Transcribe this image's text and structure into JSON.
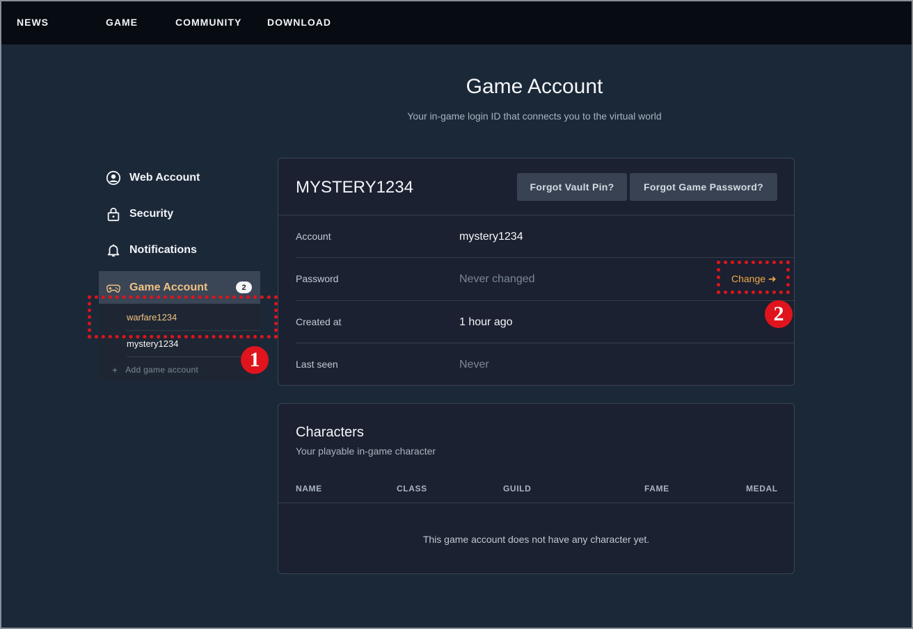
{
  "nav": {
    "items": [
      "NEWS",
      "GAME",
      "COMMUNITY",
      "DOWNLOAD"
    ]
  },
  "page": {
    "title": "Game Account",
    "subtitle": "Your in-game login ID that connects you to the virtual world"
  },
  "sidebar": {
    "items": [
      {
        "label": "Web Account",
        "icon": "user-circle-icon"
      },
      {
        "label": "Security",
        "icon": "lock-icon"
      },
      {
        "label": "Notifications",
        "icon": "bell-icon"
      }
    ],
    "game_account": {
      "label": "Game Account",
      "icon": "gamepad-icon",
      "badge": "2",
      "accounts": [
        "warfare1234",
        "mystery1234"
      ],
      "add_label": "Add game account",
      "add_symbol": "+"
    }
  },
  "account_card": {
    "name": "MYSTERY1234",
    "forgot_vault_pin": "Forgot Vault Pin?",
    "forgot_game_password": "Forgot Game Password?",
    "rows": {
      "account": {
        "label": "Account",
        "value": "mystery1234"
      },
      "password": {
        "label": "Password",
        "value": "Never changed",
        "action": "Change ➜"
      },
      "created": {
        "label": "Created at",
        "value": "1 hour ago"
      },
      "last_seen": {
        "label": "Last seen",
        "value": "Never"
      }
    }
  },
  "characters_card": {
    "title": "Characters",
    "subtitle": "Your playable in-game character",
    "columns": [
      "NAME",
      "CLASS",
      "GUILD",
      "FAME",
      "MEDAL"
    ],
    "empty_message": "This game account does not have any character yet."
  },
  "annotations": [
    "1",
    "2"
  ],
  "colors": {
    "background": "#1b2838",
    "topnav": "#070b12",
    "accent": "#f0a94a",
    "annotation": "#e0141c"
  }
}
